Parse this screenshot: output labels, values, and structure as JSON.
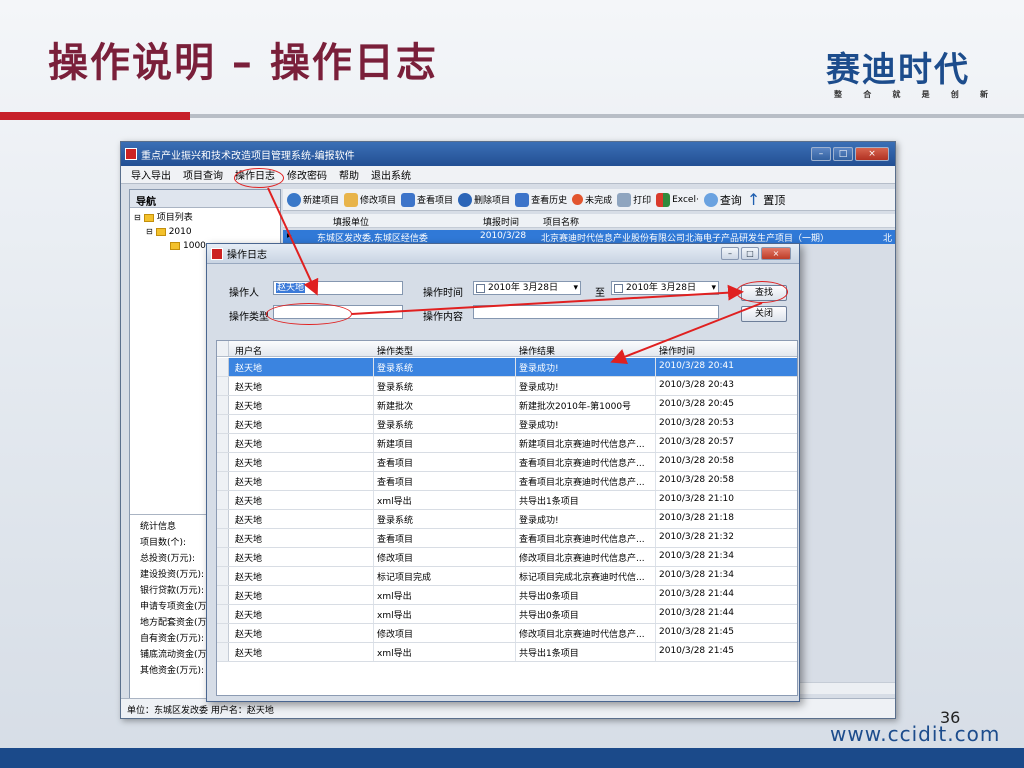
{
  "slide": {
    "title": "操作说明 – 操作日志",
    "page_number": "36",
    "website": "www.ccidit.com"
  },
  "logo": {
    "main": "赛迪时代",
    "sub": [
      "整",
      "合",
      "就",
      "是",
      "创",
      "新"
    ]
  },
  "app": {
    "window_title": "重点产业振兴和技术改造项目管理系统-编报软件",
    "menu": [
      "导入导出",
      "项目查询",
      "操作日志",
      "修改密码",
      "帮助",
      "退出系统"
    ],
    "nav_title": "导航",
    "tree": [
      {
        "label": "项目列表"
      },
      {
        "label": "2010"
      },
      {
        "label": "1000"
      }
    ],
    "stats": [
      "统计信息",
      "项目数(个):",
      "总投资(万元):",
      "建设投资(万元):",
      "银行贷款(万元):",
      "申请专项资金(万",
      "地方配套资金(万",
      "自有资金(万元):",
      "铺底流动资金(万",
      "其他资金(万元):"
    ],
    "toolbar": [
      "新建项目",
      "修改项目",
      "查看项目",
      "删除项目",
      "查看历史",
      "未完成",
      "打印",
      "Excel·",
      "查询",
      "置顶"
    ],
    "grid": {
      "headers": [
        "填报单位",
        "填报时间",
        "项目名称"
      ],
      "row": [
        "东城区发改委,东城区经信委",
        "2010/3/28",
        "北京赛迪时代信息产业股份有限公司北海电子产品研发生产项目（一期）",
        "北"
      ]
    },
    "status": "单位：东城区发改委  用户名：赵天地"
  },
  "dialog": {
    "title": "操作日志",
    "operator_label": "操作人",
    "operator_value": "赵天地",
    "op_type_label": "操作类型",
    "op_time_label": "操作时间",
    "date_from": "2010年 3月28日",
    "to_label": "至",
    "date_to": "2010年 3月28日",
    "op_content_label": "操作内容",
    "search_button": "查找",
    "close_button": "关闭",
    "columns": [
      "用户名",
      "操作类型",
      "操作结果",
      "操作时间"
    ],
    "rows": [
      [
        "赵天地",
        "登录系统",
        "登录成功!",
        "2010/3/28 20:41"
      ],
      [
        "赵天地",
        "登录系统",
        "登录成功!",
        "2010/3/28 20:43"
      ],
      [
        "赵天地",
        "新建批次",
        "新建批次2010年-第1000号",
        "2010/3/28 20:45"
      ],
      [
        "赵天地",
        "登录系统",
        "登录成功!",
        "2010/3/28 20:53"
      ],
      [
        "赵天地",
        "新建项目",
        "新建项目北京赛迪时代信息产...",
        "2010/3/28 20:57"
      ],
      [
        "赵天地",
        "查看项目",
        "查看项目北京赛迪时代信息产...",
        "2010/3/28 20:58"
      ],
      [
        "赵天地",
        "查看项目",
        "查看项目北京赛迪时代信息产...",
        "2010/3/28 20:58"
      ],
      [
        "赵天地",
        "xml导出",
        "共导出1条项目",
        "2010/3/28 21:10"
      ],
      [
        "赵天地",
        "登录系统",
        "登录成功!",
        "2010/3/28 21:18"
      ],
      [
        "赵天地",
        "查看项目",
        "查看项目北京赛迪时代信息产...",
        "2010/3/28 21:32"
      ],
      [
        "赵天地",
        "修改项目",
        "修改项目北京赛迪时代信息产...",
        "2010/3/28 21:34"
      ],
      [
        "赵天地",
        "标记项目完成",
        "标记项目完成北京赛迪时代信...",
        "2010/3/28 21:34"
      ],
      [
        "赵天地",
        "xml导出",
        "共导出0条项目",
        "2010/3/28 21:44"
      ],
      [
        "赵天地",
        "xml导出",
        "共导出0条项目",
        "2010/3/28 21:44"
      ],
      [
        "赵天地",
        "修改项目",
        "修改项目北京赛迪时代信息产...",
        "2010/3/28 21:45"
      ],
      [
        "赵天地",
        "xml导出",
        "共导出1条项目",
        "2010/3/28 21:45"
      ]
    ]
  },
  "colors": {
    "title": "#7a1f3a",
    "logo": "#1c4c8c",
    "accent_red": "#c7202a",
    "selection": "#3b84e0",
    "annotation": "#e02020"
  }
}
